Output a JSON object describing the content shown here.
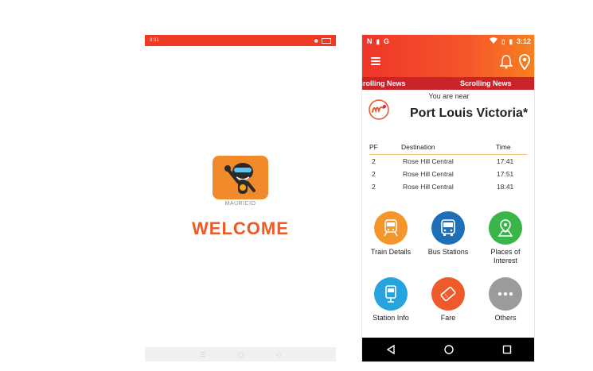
{
  "splash": {
    "status_time": "8:31",
    "logo_label": "MAURICIO",
    "welcome": "WELCOME"
  },
  "app": {
    "status_left": [
      "N",
      "G"
    ],
    "status_time": "3:12",
    "ticker": [
      "Scrolling News",
      "Scrolling News"
    ],
    "near_label": "You are near",
    "station": "Port Louis Victoria*",
    "table": {
      "headers": [
        "PF",
        "Destination",
        "Time"
      ],
      "rows": [
        {
          "pf": "2",
          "dest": "Rose Hill Central",
          "time": "17:41"
        },
        {
          "pf": "2",
          "dest": "Rose Hill Central",
          "time": "17:51"
        },
        {
          "pf": "2",
          "dest": "Rose Hill Central",
          "time": "18:41"
        }
      ]
    },
    "tiles": [
      {
        "label": "Train Details",
        "color": "#f4962b",
        "icon": "train-icon"
      },
      {
        "label": "Bus Stations",
        "color": "#1e6fb5",
        "icon": "bus-icon"
      },
      {
        "label": "Places of Interest",
        "color": "#39b54a",
        "icon": "map-pin-icon"
      },
      {
        "label": "Station Info",
        "color": "#27a3dd",
        "icon": "station-sign-icon"
      },
      {
        "label": "Fare",
        "color": "#ee5a2a",
        "icon": "ticket-icon"
      },
      {
        "label": "Others",
        "color": "#9b9b9b",
        "icon": "more-icon"
      }
    ],
    "colors": {
      "header_start": "#f0352a",
      "header_end": "#f7811f",
      "ticker": "#c9242a"
    }
  }
}
